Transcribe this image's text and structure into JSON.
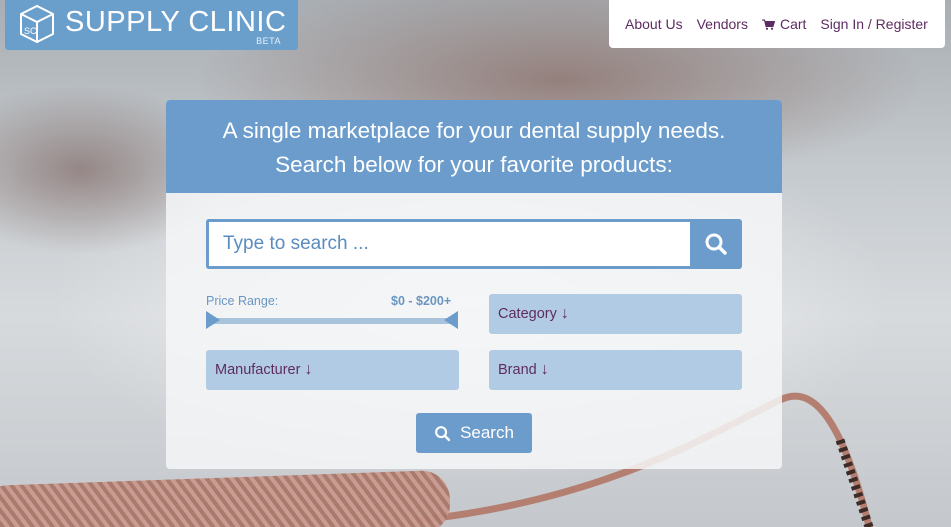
{
  "logo": {
    "monogram": "SC",
    "name": "SUPPLY CLINIC",
    "badge": "BETA"
  },
  "nav": {
    "items": [
      {
        "label": "About Us"
      },
      {
        "label": "Vendors"
      },
      {
        "label": "Cart",
        "icon": "cart-icon"
      },
      {
        "label": "Sign In / Register"
      }
    ]
  },
  "hero": {
    "line1": "A single marketplace for your dental supply needs.",
    "line2": "Search below for your favorite products:"
  },
  "search": {
    "placeholder": "Type to search ...",
    "value": "",
    "button_icon": "search-icon"
  },
  "filters": {
    "price_label": "Price Range:",
    "price_value": "$0 - $200+",
    "category": "Category",
    "manufacturer": "Manufacturer",
    "brand": "Brand",
    "dropdown_arrow": "↓"
  },
  "submit": {
    "label": "Search",
    "icon": "search-icon"
  },
  "colors": {
    "brand_blue": "#6b9ccb",
    "dropdown_bg": "#b2cbe4",
    "nav_text": "#5e2c61"
  }
}
